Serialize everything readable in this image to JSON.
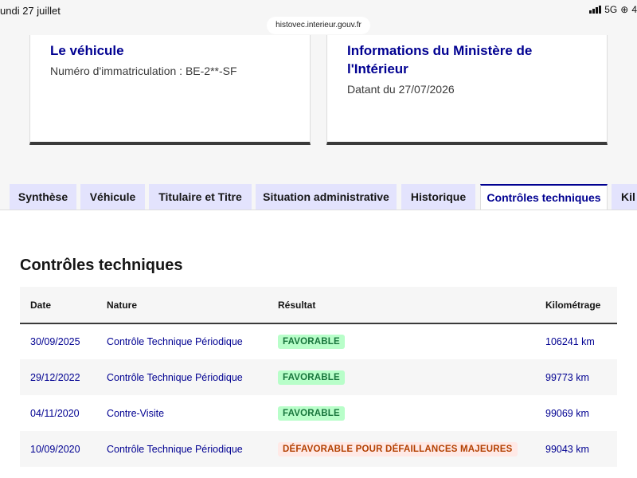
{
  "status_bar": {
    "date": "undi 27 juillet",
    "network": "5G",
    "battery_partial": "4"
  },
  "browser": {
    "url": "histovec.interieur.gouv.fr"
  },
  "cards": {
    "vehicle": {
      "title": "Le véhicule",
      "text": "Numéro d'immatriculation : BE-2**-SF"
    },
    "ministry": {
      "title_line1": "Informations du Ministère de",
      "title_line2": "l'Intérieur",
      "text": "Datant du 27/07/2026"
    }
  },
  "tabs": [
    "Synthèse",
    "Véhicule",
    "Titulaire et Titre",
    "Situation administrative",
    "Historique",
    "Contrôles techniques",
    "Kil"
  ],
  "active_tab": "Contrôles techniques",
  "section_title": "Contrôles techniques",
  "table": {
    "headers": [
      "Date",
      "Nature",
      "Résultat",
      "Kilométrage"
    ],
    "rows": [
      {
        "date": "30/09/2025",
        "nature": "Contrôle Technique Périodique",
        "result": "FAVORABLE",
        "km": "106241 km"
      },
      {
        "date": "29/12/2022",
        "nature": "Contrôle Technique Périodique",
        "result": "FAVORABLE",
        "km": "99773 km"
      },
      {
        "date": "04/11/2020",
        "nature": "Contre-Visite",
        "result": "FAVORABLE",
        "km": "99069 km"
      },
      {
        "date": "10/09/2020",
        "nature": "Contrôle Technique Périodique",
        "result": "DÉFAVORABLE POUR DÉFAILLANCES MAJEURES",
        "km": "99043 km"
      }
    ]
  },
  "colors": {
    "accent": "#000091",
    "favorable_bg": "#b8fec9",
    "favorable_text": "#18753c",
    "unfavorable_bg": "#ffe9e6",
    "unfavorable_text": "#b34000"
  }
}
